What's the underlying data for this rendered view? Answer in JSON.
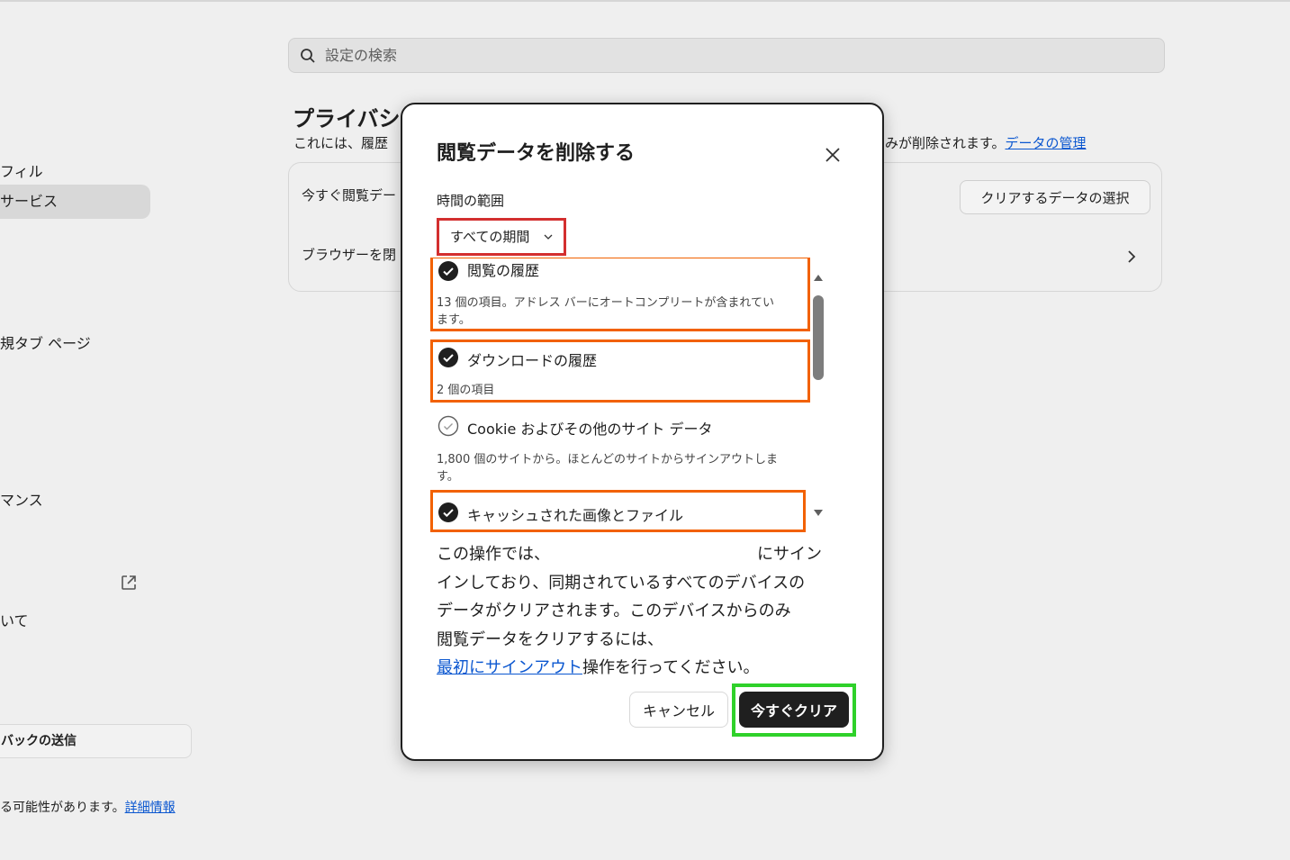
{
  "search": {
    "placeholder": "設定の検索"
  },
  "sidebar": {
    "items": [
      {
        "label": "フィル"
      },
      {
        "label": "サービス"
      },
      {
        "label": "規タブ ページ"
      },
      {
        "label": "マンス"
      },
      {
        "label": "いて"
      }
    ],
    "feedback_label": "バックの送信",
    "footnote_text": "る可能性があります。",
    "footnote_link": "詳細情報"
  },
  "section": {
    "title": "プライバシ",
    "desc_left": "これには、履歴",
    "desc_right": "みが削除されます。",
    "desc_link": "データの管理"
  },
  "card": {
    "row1": "今すぐ閲覧デー",
    "row2": "ブラウザーを閉",
    "select_button": "クリアするデータの選択"
  },
  "dialog": {
    "title": "閲覧データを削除する",
    "range_label": "時間の範囲",
    "range_value": "すべての期間",
    "items": [
      {
        "label": "閲覧の履歴",
        "sub1": "13 個の項目。アドレス バーにオートコンプリートが含まれてい",
        "sub2": "ます。",
        "checked": true
      },
      {
        "label": "ダウンロードの履歴",
        "sub1": "2 個の項目",
        "checked": true
      },
      {
        "label": "Cookie およびその他のサイト データ",
        "sub1": "1,800 個のサイトから。ほとんどのサイトからサインアウトしま",
        "sub2": "す。",
        "checked": false
      },
      {
        "label": "キャッシュされた画像とファイル",
        "checked": true
      }
    ],
    "notice": {
      "line1a": "この操作では、",
      "line1b": "にサイン",
      "line2": "インしており、同期されているすべてのデバイスの",
      "line3": "データがクリアされます。このデバイスからのみ",
      "line4": "閲覧データをクリアするには、",
      "link": "最初にサインアウト",
      "line5": "操作を行ってください。"
    },
    "cancel_label": "キャンセル",
    "clear_label": "今すぐクリア"
  },
  "colors": {
    "accent_link": "#0b57d0",
    "highlight_red": "#d32f2f",
    "highlight_orange": "#f26100",
    "highlight_green": "#2fd12a",
    "primary_button": "#1f1f1f"
  }
}
